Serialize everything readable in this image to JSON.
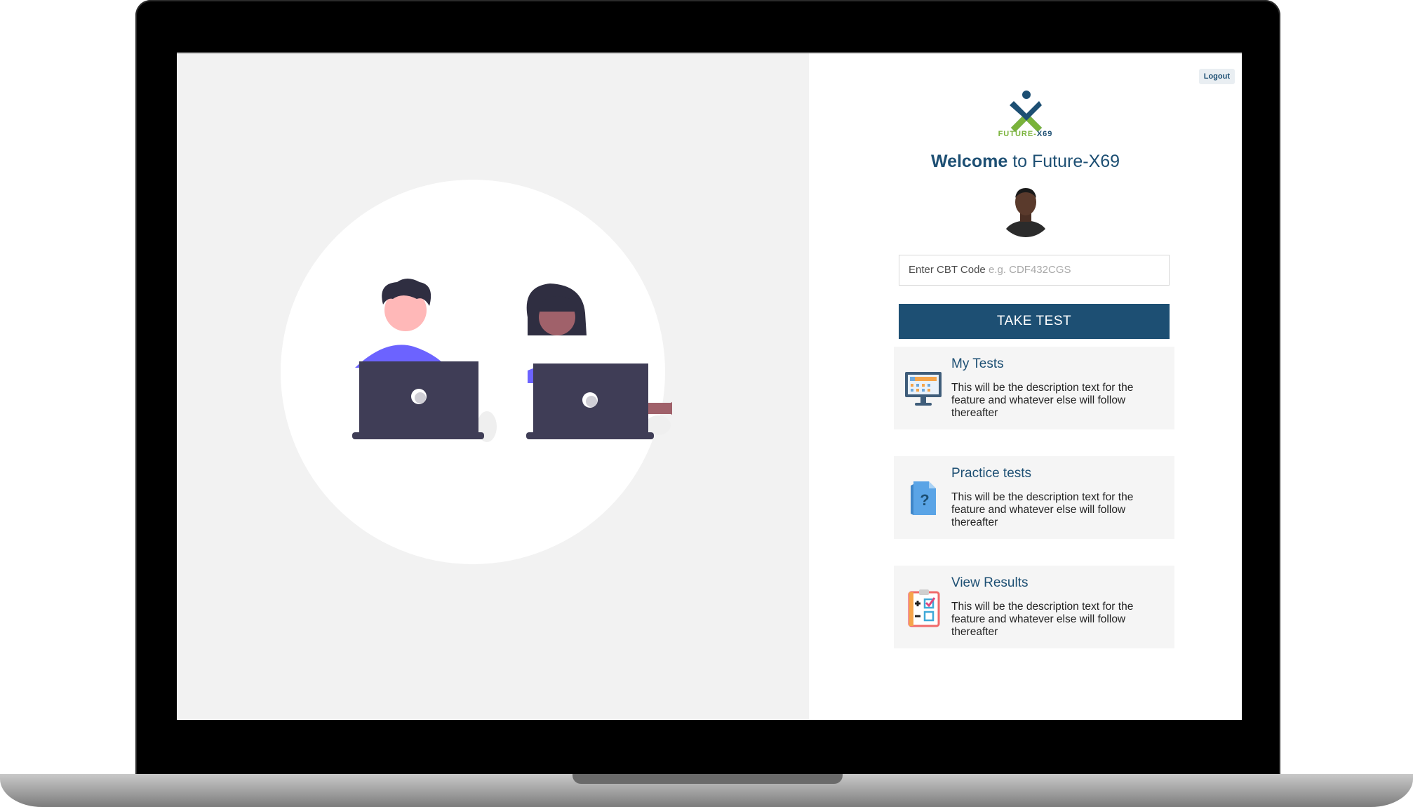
{
  "header": {
    "logout_label": "Logout"
  },
  "brand": {
    "logo_text_prefix": "FUTURE-",
    "logo_text_suffix": "X69"
  },
  "welcome": {
    "bold": "Welcome",
    "rest": " to Future-X69"
  },
  "cbt": {
    "label": "Enter CBT Code",
    "hint": " e.g. CDF432CGS"
  },
  "take_test_label": "TAKE TEST",
  "cards": [
    {
      "title": "My Tests",
      "description": "This will be the description text for the feature and whatever else will follow thereafter",
      "icon": "monitor-icon"
    },
    {
      "title": "Practice tests",
      "description": "This will be the description text for the feature and whatever else will follow thereafter",
      "icon": "question-document-icon"
    },
    {
      "title": "View Results",
      "description": "This will be the description text for the feature and whatever else will follow thereafter",
      "icon": "checklist-icon"
    }
  ],
  "colors": {
    "primary": "#1d4f73",
    "accent": "#7ab33b",
    "card_bg": "#f5f5f5"
  }
}
